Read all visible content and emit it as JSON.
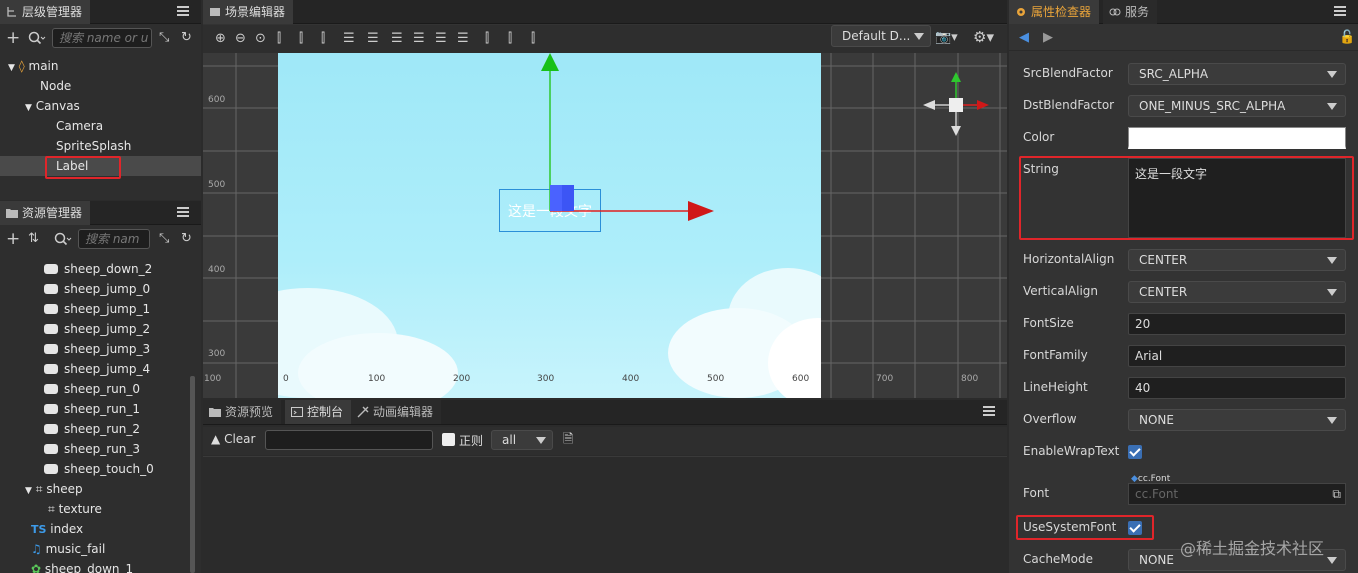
{
  "hierarchy": {
    "tab_label": "层级管理器",
    "search_placeholder": "搜索 name or u",
    "items": [
      {
        "label": "main"
      },
      {
        "label": "Node"
      },
      {
        "label": "Canvas"
      },
      {
        "label": "Camera"
      },
      {
        "label": "SpriteSplash"
      },
      {
        "label": "Label"
      }
    ]
  },
  "assets": {
    "tab_label": "资源管理器",
    "search_placeholder": "搜索 nam",
    "items": [
      {
        "label": "sheep_down_2"
      },
      {
        "label": "sheep_jump_0"
      },
      {
        "label": "sheep_jump_1"
      },
      {
        "label": "sheep_jump_2"
      },
      {
        "label": "sheep_jump_3"
      },
      {
        "label": "sheep_jump_4"
      },
      {
        "label": "sheep_run_0"
      },
      {
        "label": "sheep_run_1"
      },
      {
        "label": "sheep_run_2"
      },
      {
        "label": "sheep_run_3"
      },
      {
        "label": "sheep_touch_0"
      },
      {
        "label": "sheep"
      },
      {
        "label": "texture"
      },
      {
        "label": "index"
      },
      {
        "label": "music_fail"
      },
      {
        "label": "sheep_down_1"
      }
    ],
    "ts_badge": "TS"
  },
  "scene": {
    "tab_label": "场景编辑器",
    "camera_select": "Default D...",
    "label_text": "这是一段文字",
    "ruler_y": [
      "600",
      "500",
      "400",
      "300"
    ],
    "ruler_x": [
      "0",
      "100",
      "200",
      "300",
      "400",
      "500",
      "600"
    ],
    "ruler_x_outside": [
      "100",
      "700",
      "800"
    ]
  },
  "bottom": {
    "tabs": [
      "资源预览",
      "控制台",
      "动画编辑器"
    ],
    "clear_label": "Clear",
    "regex_label": "正则",
    "filter_value": "all"
  },
  "inspector": {
    "tab_label": "属性检查器",
    "service_tab": "服务",
    "props": {
      "src_blend_label": "SrcBlendFactor",
      "src_blend_value": "SRC_ALPHA",
      "dst_blend_label": "DstBlendFactor",
      "dst_blend_value": "ONE_MINUS_SRC_ALPHA",
      "color_label": "Color",
      "string_label": "String",
      "string_value": "这是一段文字",
      "halign_label": "HorizontalAlign",
      "halign_value": "CENTER",
      "valign_label": "VerticalAlign",
      "valign_value": "CENTER",
      "fontsize_label": "FontSize",
      "fontsize_value": "20",
      "fontfamily_label": "FontFamily",
      "fontfamily_value": "Arial",
      "lineheight_label": "LineHeight",
      "lineheight_value": "40",
      "overflow_label": "Overflow",
      "overflow_value": "NONE",
      "wrap_label": "EnableWrapText",
      "wrap_checked": true,
      "font_label": "Font",
      "font_badge": "cc.Font",
      "font_placeholder": "cc.Font",
      "usesys_label": "UseSystemFont",
      "usesys_checked": true,
      "cache_label": "CacheMode",
      "cache_value": "NONE"
    }
  },
  "watermark": "@稀土掘金技术社区",
  "colors": {
    "highlight_red": "#e0252a",
    "accent_blue": "#3a6fb4",
    "scene_sky": "#a8ecf8"
  }
}
